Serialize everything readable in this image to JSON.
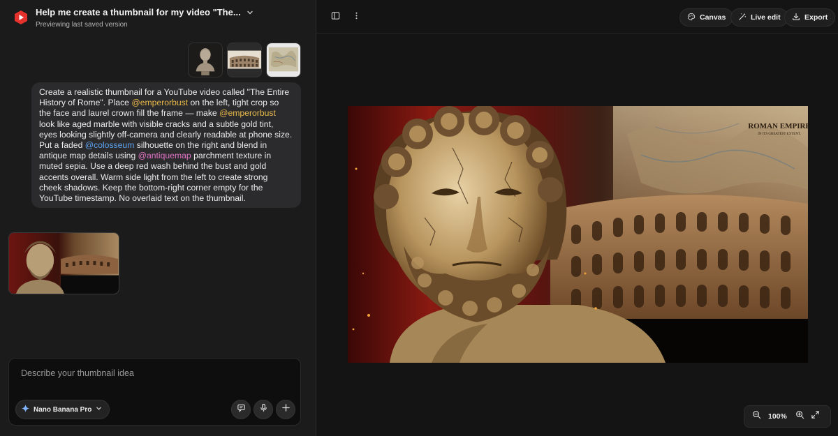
{
  "header": {
    "title": "Help me create a thumbnail for my video \"The...",
    "subtitle": "Previewing last saved version"
  },
  "references": [
    {
      "name": "emperorbust"
    },
    {
      "name": "colosseum"
    },
    {
      "name": "antiquemap"
    }
  ],
  "prompt": {
    "t1": "Create a realistic thumbnail for a YouTube video called \"The Entire History of Rome\". Place ",
    "m1": "@emperorbust",
    "t2": " on the left, tight crop so the face and laurel crown fill the frame — make ",
    "m2": "@emperorbust",
    "t3": " look like aged marble with visible cracks and a subtle gold tint, eyes looking slightly off-camera and clearly readable at phone size. Put a faded ",
    "m3": "@colosseum",
    "t4": " silhouette on the right and blend in antique map details using ",
    "m4": "@antiquemap",
    "t5": " parchment texture in muted sepia. Use a deep red wash behind the bust and gold accents overall. Warm side light from the left to create strong cheek shadows. Keep the bottom-right corner empty for the YouTube timestamp. No overlaid text on the thumbnail."
  },
  "composer": {
    "placeholder": "Describe your thumbnail idea",
    "model": "Nano Banana Pro"
  },
  "toolbar": {
    "canvas": "Canvas",
    "live_edit": "Live edit",
    "export": "Export"
  },
  "preview": {
    "map_title": "ROMAN EMPIRE",
    "map_subtitle": "IN ITS GREATEST EXTENT."
  },
  "zoom": {
    "value": "100%"
  },
  "colors": {
    "brand": "#e5322d",
    "mention_gold": "#e9b949",
    "mention_blue": "#5fa3f0",
    "mention_pink": "#e074c8"
  }
}
